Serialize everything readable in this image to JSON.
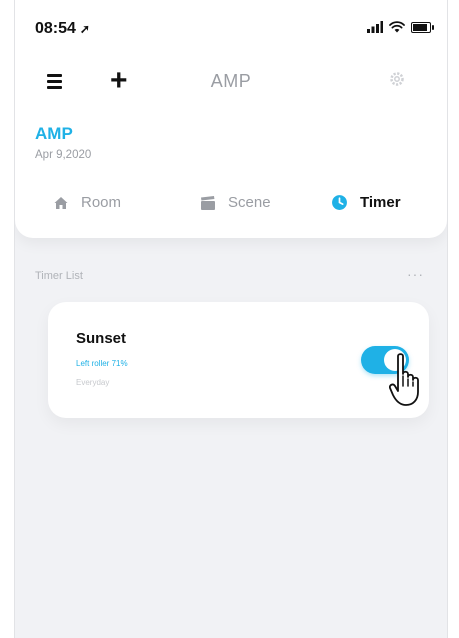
{
  "status_bar": {
    "time": "08:54",
    "location_icon": "location-arrow-icon",
    "signal_icon": "signal-icon",
    "wifi_icon": "wifi-icon",
    "battery_icon": "battery-icon"
  },
  "app": {
    "title": "AMP",
    "menu_icon": "menu-icon",
    "add_icon": "plus-icon",
    "settings_icon": "gear-icon"
  },
  "home": {
    "name": "AMP",
    "date": "Apr 9,2020"
  },
  "tabs": [
    {
      "label": "Room",
      "icon": "home-icon",
      "active": false
    },
    {
      "label": "Scene",
      "icon": "scene-icon",
      "active": false
    },
    {
      "label": "Timer",
      "icon": "clock-icon",
      "active": true
    }
  ],
  "timer_list": {
    "title": "Timer List",
    "more_label": "···",
    "items": [
      {
        "name": "Sunset",
        "detail": "Left roller 71%",
        "repeat": "Everyday",
        "enabled": true
      }
    ]
  },
  "colors": {
    "accent": "#1fb1e6",
    "background": "#f1f2f5",
    "card": "#ffffff",
    "muted": "#9a9da3"
  }
}
